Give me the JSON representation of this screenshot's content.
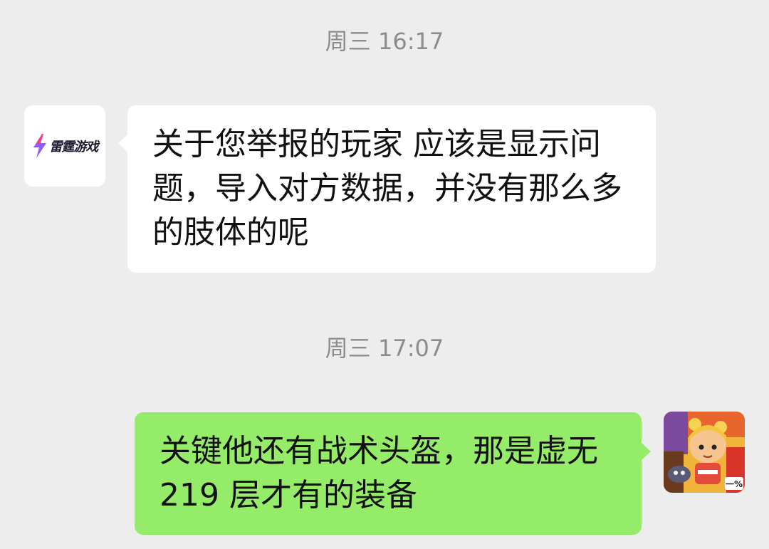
{
  "chat": {
    "timestamp_1": "周三 16:17",
    "incoming": {
      "sender_avatar": {
        "brand": "雷霆游戏",
        "icon": "lightning-bolt-icon"
      },
      "lines": [
        "关于您举报的玩家 应该是显示问",
        "题，导入对方数据，并没有那么多",
        "的肢体的呢"
      ]
    },
    "timestamp_2": "周三 17:07",
    "outgoing": {
      "lines": [
        "关键他还有战术头盔，那是虚无",
        "219 层才有的装备"
      ],
      "avatar": {
        "badge_text": "一%"
      }
    }
  },
  "colors": {
    "background": "#ededed",
    "incoming_bubble": "#ffffff",
    "outgoing_bubble": "#95ec69",
    "timestamp_text": "#8c8c8c"
  }
}
